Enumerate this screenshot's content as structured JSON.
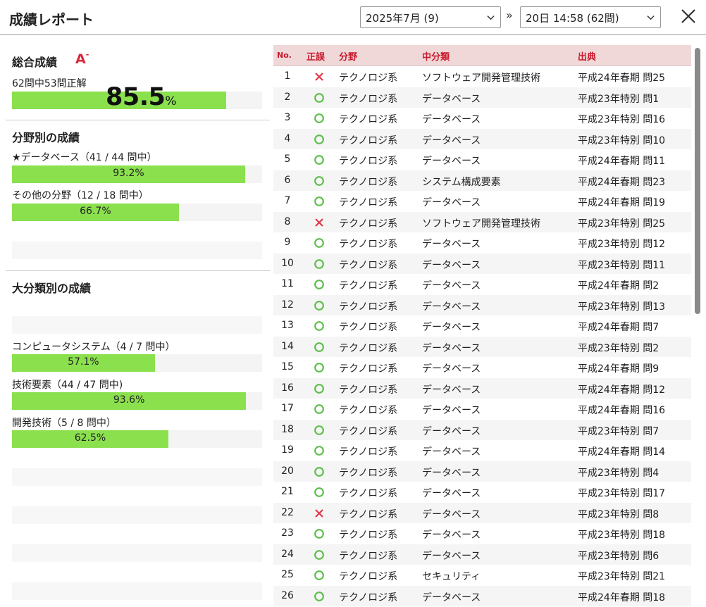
{
  "header": {
    "title": "成績レポート",
    "month_select": "2025年7月 (9)",
    "separator": "»",
    "session_select": "20日 14:58 (62問)"
  },
  "overall": {
    "title": "総合成績",
    "grade": "A",
    "grade_mark": "-",
    "summary": "62問中53問正解",
    "percent": "85.5",
    "percent_unit": "%",
    "rate": 0.855
  },
  "by_field": {
    "title": "分野別の成績",
    "items": [
      {
        "label": "★データベース（41 / 44 問中）",
        "percent": "93.2%",
        "rate": 0.932
      },
      {
        "label": "その他の分野（12 / 18 問中）",
        "percent": "66.7%",
        "rate": 0.667
      }
    ]
  },
  "by_major": {
    "title": "大分類別の成績",
    "items": [
      {
        "label": "コンピュータシステム（4 / 7 問中）",
        "percent": "57.1%",
        "rate": 0.571
      },
      {
        "label": "技術要素（44 / 47 問中)",
        "percent": "93.6%",
        "rate": 0.936
      },
      {
        "label": "開発技術（5 / 8 問中）",
        "percent": "62.5%",
        "rate": 0.625
      }
    ]
  },
  "table": {
    "headers": {
      "no": "No.",
      "result": "正誤",
      "field": "分野",
      "sub": "中分類",
      "source": "出典"
    },
    "rows": [
      {
        "no": "1",
        "correct": false,
        "field": "テクノロジ系",
        "sub": "ソフトウェア開発管理技術",
        "source": "平成24年春期 問25"
      },
      {
        "no": "2",
        "correct": true,
        "field": "テクノロジ系",
        "sub": "データベース",
        "source": "平成23年特別 問1"
      },
      {
        "no": "3",
        "correct": true,
        "field": "テクノロジ系",
        "sub": "データベース",
        "source": "平成23年特別 問16"
      },
      {
        "no": "4",
        "correct": true,
        "field": "テクノロジ系",
        "sub": "データベース",
        "source": "平成23年特別 問10"
      },
      {
        "no": "5",
        "correct": true,
        "field": "テクノロジ系",
        "sub": "データベース",
        "source": "平成24年春期 問11"
      },
      {
        "no": "6",
        "correct": true,
        "field": "テクノロジ系",
        "sub": "システム構成要素",
        "source": "平成24年春期 問23"
      },
      {
        "no": "7",
        "correct": true,
        "field": "テクノロジ系",
        "sub": "データベース",
        "source": "平成24年春期 問19"
      },
      {
        "no": "8",
        "correct": false,
        "field": "テクノロジ系",
        "sub": "ソフトウェア開発管理技術",
        "source": "平成23年特別 問25"
      },
      {
        "no": "9",
        "correct": true,
        "field": "テクノロジ系",
        "sub": "データベース",
        "source": "平成23年特別 問12"
      },
      {
        "no": "10",
        "correct": true,
        "field": "テクノロジ系",
        "sub": "データベース",
        "source": "平成23年特別 問11"
      },
      {
        "no": "11",
        "correct": true,
        "field": "テクノロジ系",
        "sub": "データベース",
        "source": "平成24年春期 問2"
      },
      {
        "no": "12",
        "correct": true,
        "field": "テクノロジ系",
        "sub": "データベース",
        "source": "平成23年特別 問13"
      },
      {
        "no": "13",
        "correct": true,
        "field": "テクノロジ系",
        "sub": "データベース",
        "source": "平成24年春期 問7"
      },
      {
        "no": "14",
        "correct": true,
        "field": "テクノロジ系",
        "sub": "データベース",
        "source": "平成23年特別 問2"
      },
      {
        "no": "15",
        "correct": true,
        "field": "テクノロジ系",
        "sub": "データベース",
        "source": "平成24年春期 問9"
      },
      {
        "no": "16",
        "correct": true,
        "field": "テクノロジ系",
        "sub": "データベース",
        "source": "平成24年春期 問12"
      },
      {
        "no": "17",
        "correct": true,
        "field": "テクノロジ系",
        "sub": "データベース",
        "source": "平成24年春期 問16"
      },
      {
        "no": "18",
        "correct": true,
        "field": "テクノロジ系",
        "sub": "データベース",
        "source": "平成23年特別 問7"
      },
      {
        "no": "19",
        "correct": true,
        "field": "テクノロジ系",
        "sub": "データベース",
        "source": "平成24年春期 問14"
      },
      {
        "no": "20",
        "correct": true,
        "field": "テクノロジ系",
        "sub": "データベース",
        "source": "平成23年特別 問4"
      },
      {
        "no": "21",
        "correct": true,
        "field": "テクノロジ系",
        "sub": "データベース",
        "source": "平成23年特別 問17"
      },
      {
        "no": "22",
        "correct": false,
        "field": "テクノロジ系",
        "sub": "データベース",
        "source": "平成23年特別 問8"
      },
      {
        "no": "23",
        "correct": true,
        "field": "テクノロジ系",
        "sub": "データベース",
        "source": "平成23年特別 問18"
      },
      {
        "no": "24",
        "correct": true,
        "field": "テクノロジ系",
        "sub": "データベース",
        "source": "平成23年特別 問6"
      },
      {
        "no": "25",
        "correct": true,
        "field": "テクノロジ系",
        "sub": "セキュリティ",
        "source": "平成23年特別 問21"
      },
      {
        "no": "26",
        "correct": true,
        "field": "テクノロジ系",
        "sub": "データベース",
        "source": "平成24年春期 問18"
      }
    ]
  },
  "colors": {
    "bar": "#8be04e",
    "correct": "#5cbf4a",
    "wrong": "#e03a4a",
    "header_bg": "#f0d8d8",
    "header_text": "#c8182c"
  }
}
